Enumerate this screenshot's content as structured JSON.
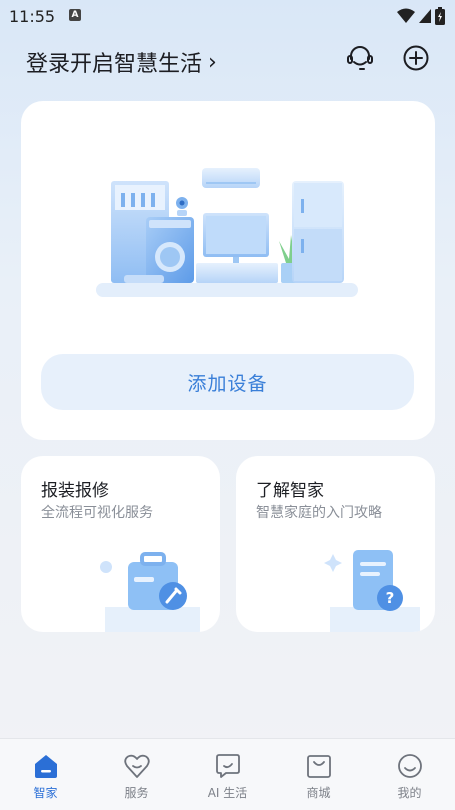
{
  "status_bar": {
    "time": "11:55",
    "app_icon_letter": "A"
  },
  "header": {
    "login_title": "登录开启智慧生活",
    "login_chevron": "›",
    "icons": [
      "customer-service-icon",
      "plus-circle-icon"
    ]
  },
  "main_card": {
    "add_device_label": "添加设备"
  },
  "cards": [
    {
      "title": "报装报修",
      "subtitle": "全流程可视化服务"
    },
    {
      "title": "了解智家",
      "subtitle": "智慧家庭的入门攻略"
    }
  ],
  "tabbar": {
    "active_index": 0,
    "accent_color": "#2b6fd6",
    "tabs": [
      {
        "label": "智家",
        "icon": "home-icon"
      },
      {
        "label": "服务",
        "icon": "heart-icon"
      },
      {
        "label": "AI 生活",
        "icon": "ai-chat-icon"
      },
      {
        "label": "商城",
        "icon": "shop-bag-icon"
      },
      {
        "label": "我的",
        "icon": "smile-face-icon"
      }
    ]
  }
}
